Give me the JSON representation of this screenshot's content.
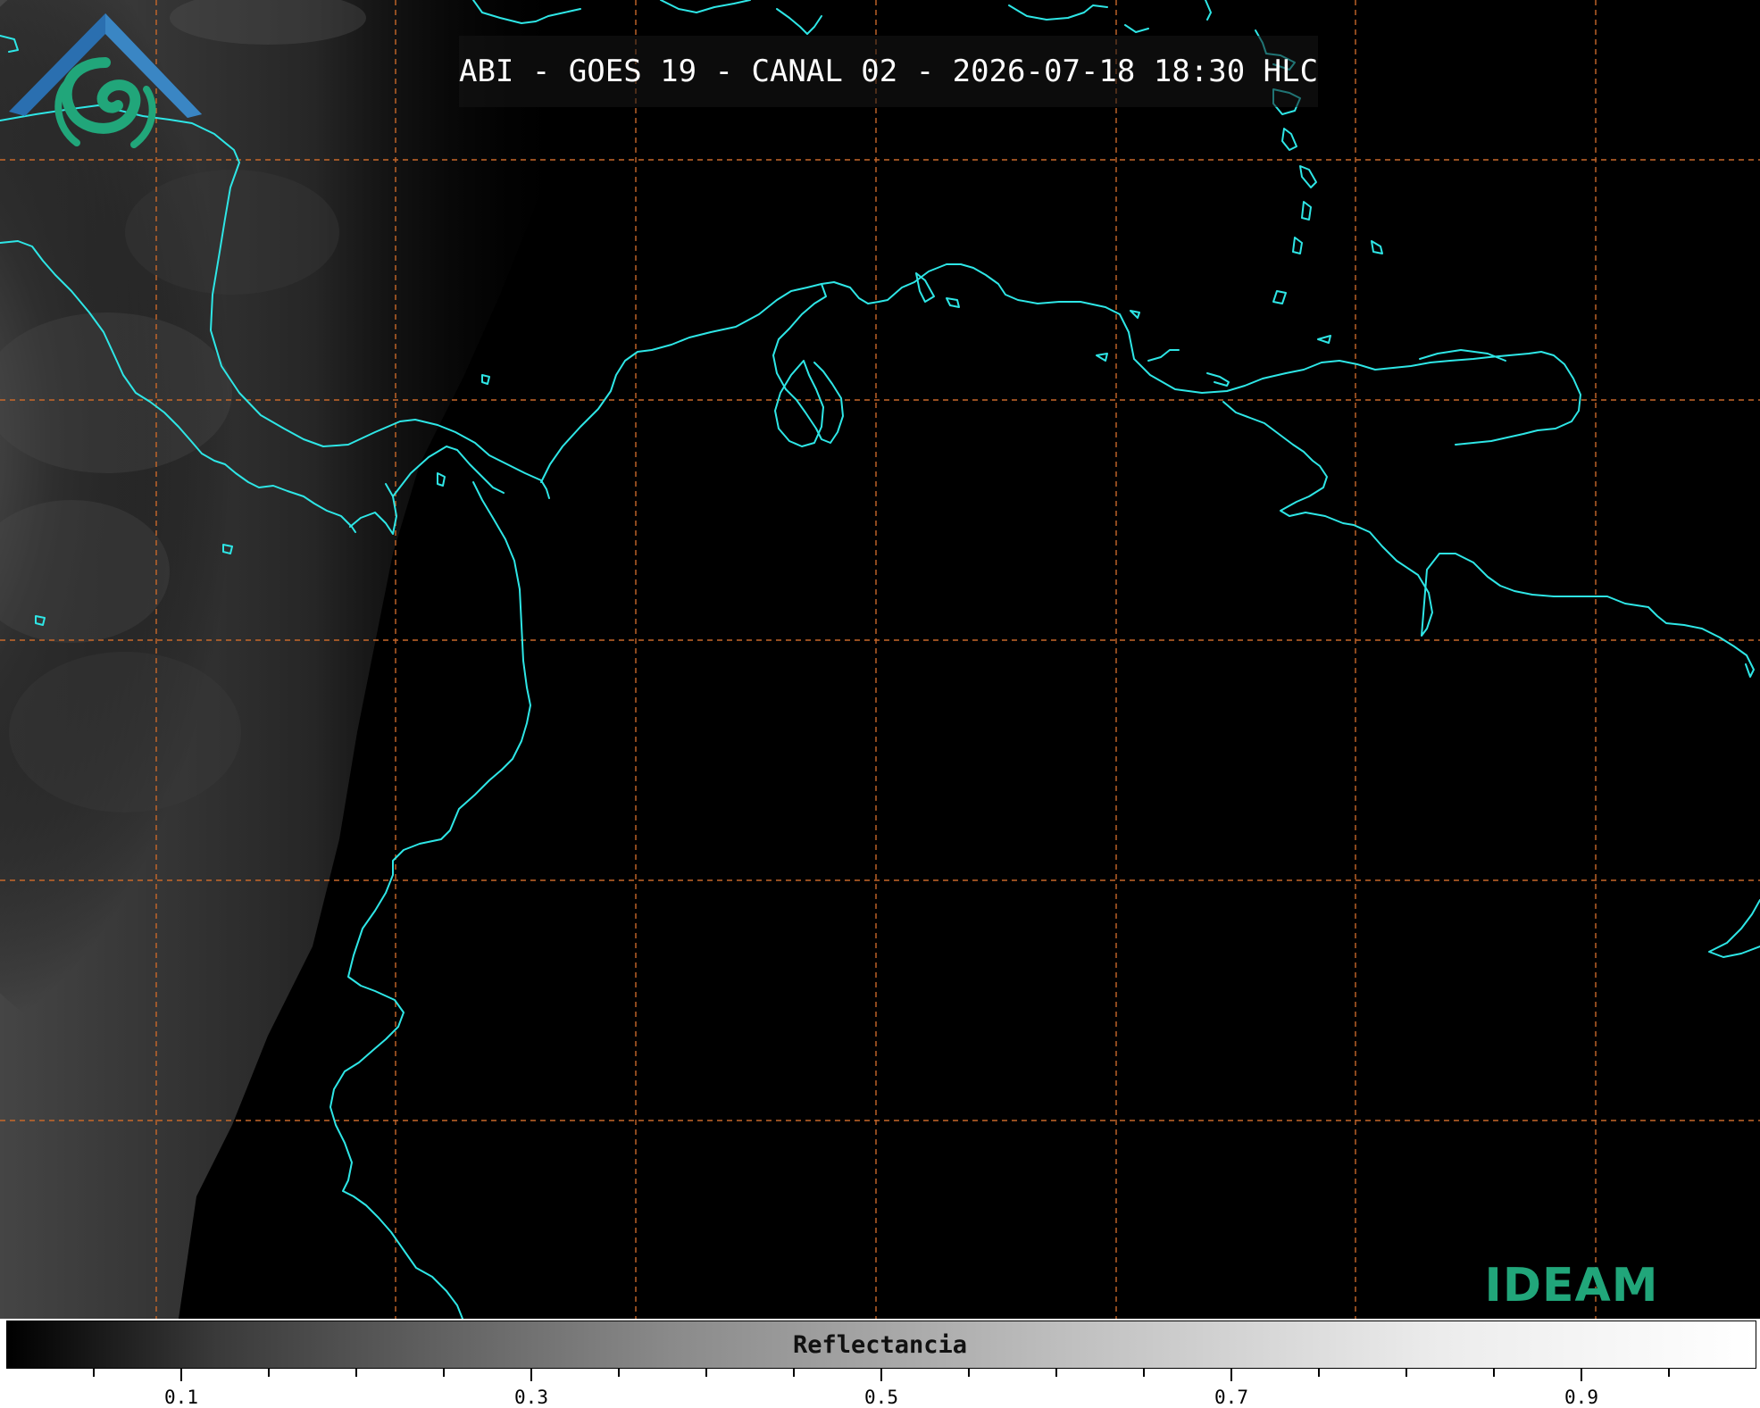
{
  "title": "ABI - GOES 19 - CANAL 02 - 2026-07-18 18:30 HLC",
  "logo_text": "IDEAM",
  "colorbar": {
    "label": "Reflectancia",
    "min": 0.0,
    "max": 1.0,
    "major_ticks": [
      0.1,
      0.3,
      0.5,
      0.7,
      0.9
    ],
    "major_tick_labels": [
      "0.1",
      "0.3",
      "0.5",
      "0.7",
      "0.9"
    ],
    "minor_ticks": [
      0.05,
      0.15,
      0.2,
      0.25,
      0.35,
      0.4,
      0.45,
      0.55,
      0.6,
      0.65,
      0.75,
      0.8,
      0.85,
      0.95
    ]
  },
  "colors": {
    "background": "#000000",
    "coastline": "#2ee6e6",
    "graticule": "#c8682a",
    "logo_blue": "#2a6fb0",
    "logo_teal": "#21a67a"
  }
}
